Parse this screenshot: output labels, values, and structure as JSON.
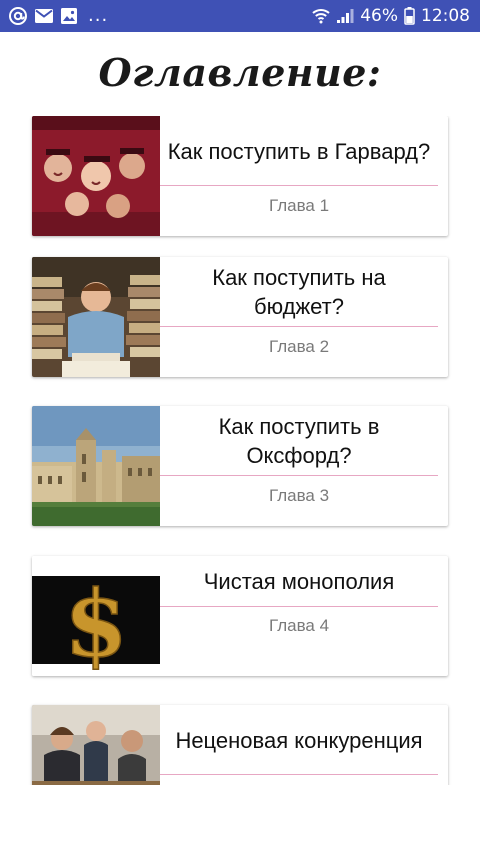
{
  "status_bar": {
    "left_icons": [
      "at-sign-icon",
      "mail-icon",
      "image-icon"
    ],
    "more": "...",
    "battery": "46%",
    "time": "12:08"
  },
  "page": {
    "title": "Оглавление:"
  },
  "chapters": [
    {
      "title": "Как поступить в Гарвард?",
      "chapter": "Глава 1",
      "image": "graduates-photo"
    },
    {
      "title": "Как поступить на бюджет?",
      "chapter": "Глава 2",
      "image": "student-with-books-photo"
    },
    {
      "title": "Как поступить в Оксфорд?",
      "chapter": "Глава 3",
      "image": "oxford-college-photo"
    },
    {
      "title": "Чистая монополия",
      "chapter": "Глава 4",
      "image": "gold-dollar-sign-photo"
    },
    {
      "title": "Неценовая конкуренция",
      "chapter": "",
      "image": "business-meeting-photo"
    }
  ],
  "colors": {
    "status_bar": "#3f51b5",
    "divider": "#e7a7c3",
    "chapter_text": "#7a7a7a"
  }
}
